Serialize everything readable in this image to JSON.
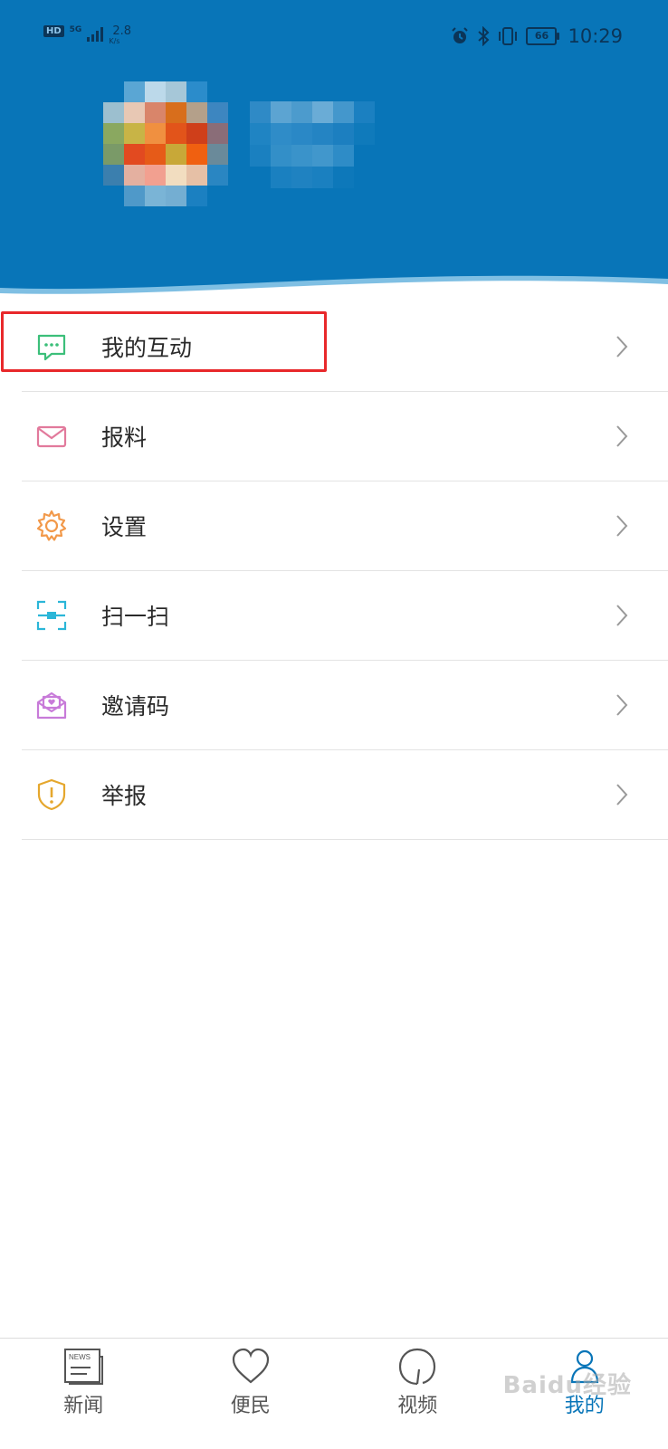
{
  "status_bar": {
    "hd": "HD",
    "signal_label": "5G",
    "net_speed": "2.8",
    "net_unit": "K/s",
    "battery": "66",
    "time": "10:29"
  },
  "menu": {
    "items": [
      {
        "label": "我的互动",
        "icon": "chat-icon",
        "color": "#3cbf7a"
      },
      {
        "label": "报料",
        "icon": "mail-icon",
        "color": "#e27a9c"
      },
      {
        "label": "设置",
        "icon": "gear-icon",
        "color": "#f2994a"
      },
      {
        "label": "扫一扫",
        "icon": "scan-icon",
        "color": "#2bb6d8"
      },
      {
        "label": "邀请码",
        "icon": "invite-icon",
        "color": "#c87bd9"
      },
      {
        "label": "举报",
        "icon": "shield-icon",
        "color": "#e5a72d"
      }
    ]
  },
  "bottom_nav": {
    "items": [
      {
        "label": "新闻",
        "icon": "news-icon",
        "active": false
      },
      {
        "label": "便民",
        "icon": "heart-icon",
        "active": false
      },
      {
        "label": "视频",
        "icon": "video-icon",
        "active": false
      },
      {
        "label": "我的",
        "icon": "user-icon",
        "active": true
      }
    ]
  },
  "watermark": "Baidu经验",
  "colors": {
    "header": "#0875b8",
    "accent": "#0875b8",
    "highlight": "#e8282b"
  }
}
